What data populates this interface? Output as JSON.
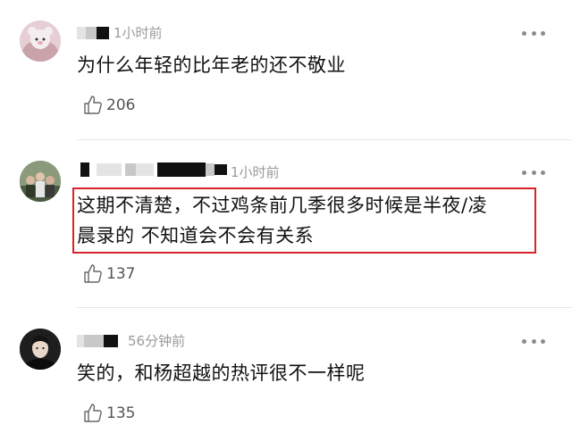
{
  "comments": [
    {
      "time": "1小时前",
      "text_lines": [
        "为什么年轻的比年老的还不敬业"
      ],
      "likes": "206",
      "avatar": "plush-toy-avatar"
    },
    {
      "time": "1小时前",
      "text_lines": [
        "这期不清楚，不过鸡条前几季很多时候是半夜/凌",
        "晨录的   不知道会不会有关系"
      ],
      "likes": "137",
      "avatar": "group-photo-avatar",
      "highlighted": true
    },
    {
      "time": "56分钟前",
      "text_lines": [
        "笑的，和杨超越的热评很不一样呢"
      ],
      "likes": "135",
      "avatar": "portrait-avatar"
    }
  ],
  "colors": {
    "highlight_border": "#d8232a",
    "secondary_text": "#9a9a9a",
    "primary_text": "#111111"
  },
  "icons": {
    "like": "thumbs-up-icon",
    "more": "more-dots-icon"
  }
}
